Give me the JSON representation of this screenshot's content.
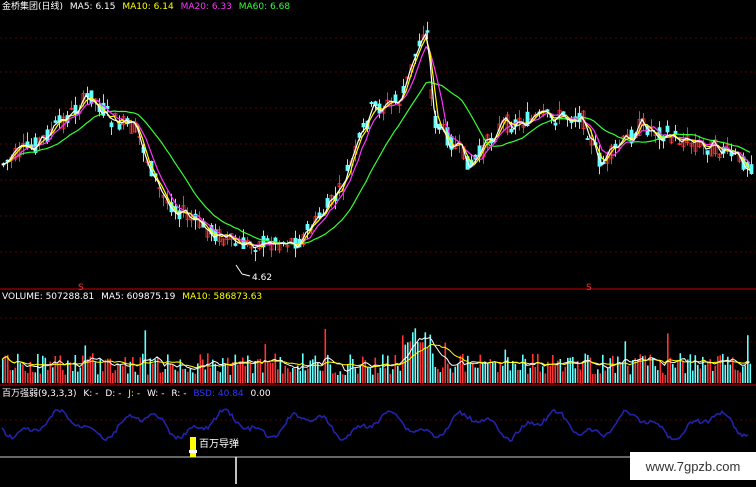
{
  "main_panel": {
    "title": "金桥集团(日线)",
    "ma": [
      {
        "label": "MA5: 6.15",
        "color": "#ffffff"
      },
      {
        "label": "MA10: 6.14",
        "color": "#ffff00"
      },
      {
        "label": "MA20: 6.33",
        "color": "#ff33ff"
      },
      {
        "label": "MA60: 6.68",
        "color": "#33ff33"
      }
    ],
    "low_marker": "4.62",
    "signal_marks": [
      "S",
      "S"
    ]
  },
  "volume_panel": {
    "labels": [
      {
        "label": "VOLUME: 507288.81",
        "color": "#ffffff"
      },
      {
        "label": "MA5: 609875.19",
        "color": "#ffffff"
      },
      {
        "label": "MA10: 586873.63",
        "color": "#ffff00"
      }
    ]
  },
  "indicator_panel": {
    "labels": [
      {
        "label": "百万强弱(9,3,3,3)",
        "color": "#ffffff"
      },
      {
        "label": "K: -",
        "color": "#ffffff"
      },
      {
        "label": "D: -",
        "color": "#ffffff"
      },
      {
        "label": "J: -",
        "color": "#ffff00"
      },
      {
        "label": "W: -",
        "color": "#ffffff"
      },
      {
        "label": "R: -",
        "color": "#ffffff"
      },
      {
        "label": "BSD: 40.84",
        "color": "#3333ff"
      },
      {
        "label": "0.00",
        "color": "#ffffff"
      }
    ],
    "annotation": "百万导弹"
  },
  "watermark": "www.7gpzb.com",
  "colors": {
    "up": "#ff3333",
    "down": "#66ffff",
    "ma5": "#ffffff",
    "ma10": "#ffff00",
    "ma20": "#ff33ff",
    "ma60": "#33ff33",
    "indicator": "#2222aa",
    "divider": "#cc0000"
  },
  "chart_data": {
    "type": "candlestick",
    "price_points": [
      6.15,
      6.14,
      6.33,
      6.68,
      4.62
    ],
    "grid": true
  }
}
